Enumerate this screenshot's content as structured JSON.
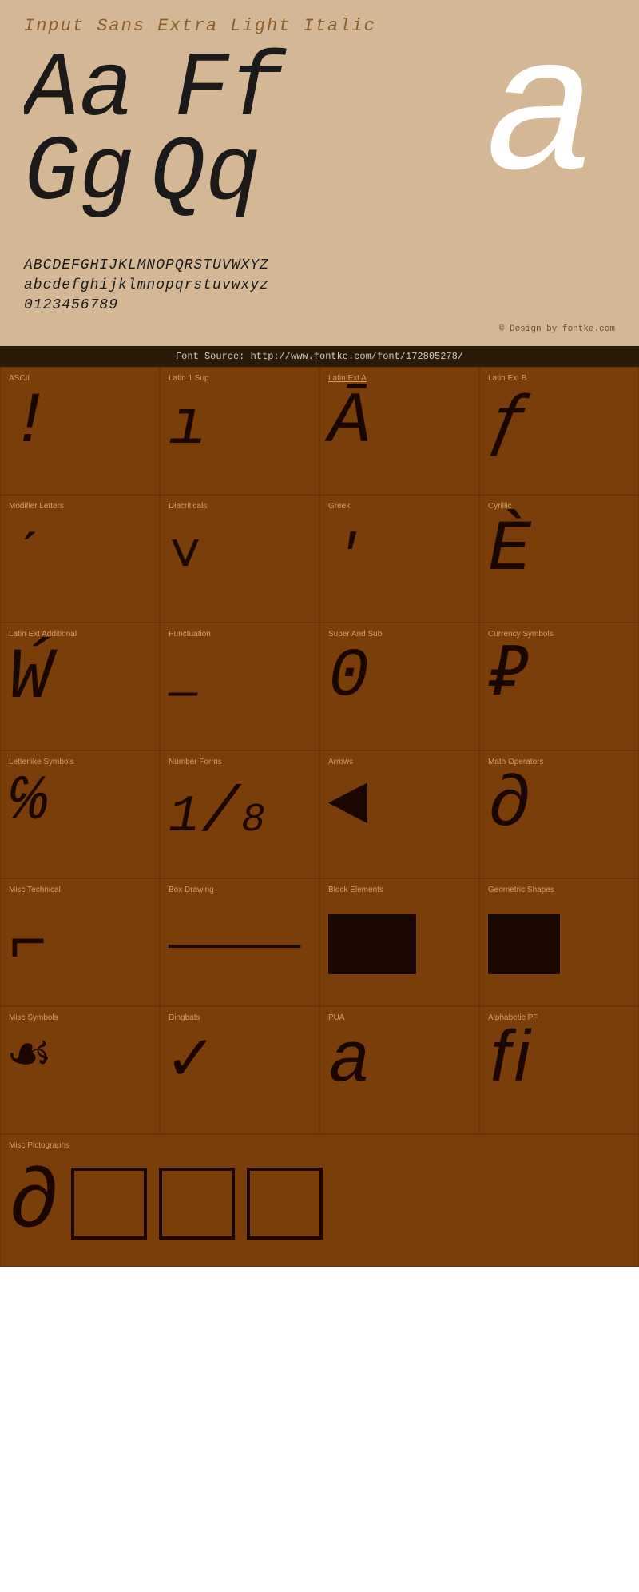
{
  "header": {
    "title": "Input Sans Extra Light Italic",
    "bg_color": "#d4b896",
    "title_color": "#8b5e2a"
  },
  "specimen": {
    "pairs": [
      "Aa",
      "Ff",
      "Gg",
      "Qq"
    ],
    "large_char": "a",
    "alphabet_upper": "ABCDEFGHIJKLMNOPQRSTUVWXYZ",
    "alphabet_lower": "abcdefghijklmnopqrstuvwxyz",
    "digits": "0123456789",
    "credit": "© Design by fontke.com",
    "source": "Font Source: http://www.fontke.com/font/172805278/"
  },
  "glyph_blocks": [
    {
      "label": "ASCII",
      "char": "!"
    },
    {
      "label": "Latin 1 Sup",
      "char": "ı"
    },
    {
      "label": "Latin Ext A",
      "char": "Ā",
      "underlined": true
    },
    {
      "label": "Latin Ext B",
      "char": "ƒ"
    },
    {
      "label": "Modifier Letters",
      "char": "ˊ"
    },
    {
      "label": "Diacriticals",
      "char": "˅"
    },
    {
      "label": "Greek",
      "char": "ʹ"
    },
    {
      "label": "Cyrillic",
      "char": "È"
    },
    {
      "label": "Latin Ext Additional",
      "char": "Ẃ"
    },
    {
      "label": "Punctuation",
      "char": "—"
    },
    {
      "label": "Super And Sub",
      "char": "⁰"
    },
    {
      "label": "Currency Symbols",
      "char": "₽"
    },
    {
      "label": "Letterlike Symbols",
      "char": "℅"
    },
    {
      "label": "Number Forms",
      "char": "⅛",
      "is_fraction": true,
      "num": "1",
      "den": "8"
    },
    {
      "label": "Arrows",
      "char": "◄"
    },
    {
      "label": "Math Operators",
      "char": "∂"
    },
    {
      "label": "Misc Technical",
      "char": "⌐"
    },
    {
      "label": "Box Drawing",
      "char": "—"
    },
    {
      "label": "Block Elements",
      "char": "block_full"
    },
    {
      "label": "Geometric Shapes",
      "char": "block_partial"
    },
    {
      "label": "Misc Symbols",
      "char": "☙"
    },
    {
      "label": "Dingbats",
      "char": "✓"
    },
    {
      "label": "PUA",
      "char": "a"
    },
    {
      "label": "Alphabetic PF",
      "char": "ﬁ"
    }
  ],
  "bottom_section": {
    "label": "Misc Pictographs",
    "chars": [
      "∂",
      "□",
      "□",
      "□"
    ]
  }
}
